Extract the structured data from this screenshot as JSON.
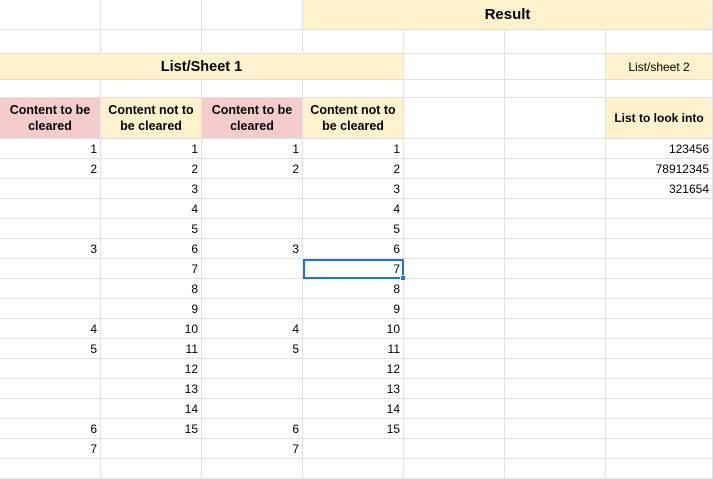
{
  "result_header": "Result",
  "list_sheet1_header": "List/Sheet 1",
  "list_sheet2_header": "List/sheet 2",
  "col_headers": [
    "Content to be cleared",
    "Content not to be cleared",
    "Content to be cleared",
    "Content not to be cleared"
  ],
  "list_header": "List to look into",
  "colA": [
    "1",
    "2",
    "",
    "",
    "",
    "3",
    "",
    "",
    "",
    "4",
    "5",
    "",
    "",
    "",
    "6",
    "7"
  ],
  "colB": [
    "1",
    "2",
    "3",
    "4",
    "5",
    "6",
    "7",
    "8",
    "9",
    "10",
    "11",
    "12",
    "13",
    "14",
    "15",
    ""
  ],
  "colC": [
    "1",
    "2",
    "",
    "",
    "",
    "3",
    "",
    "",
    "",
    "4",
    "5",
    "",
    "",
    "",
    "6",
    "7"
  ],
  "colD": [
    "1",
    "2",
    "3",
    "4",
    "5",
    "6",
    "7",
    "8",
    "9",
    "10",
    "11",
    "12",
    "13",
    "14",
    "15",
    ""
  ],
  "colG": [
    "123456",
    "78912345",
    "321654"
  ],
  "colors": {
    "header_yellow": "#fff2cc",
    "header_pink": "#f4cccc",
    "selection": "#1a73e8"
  }
}
